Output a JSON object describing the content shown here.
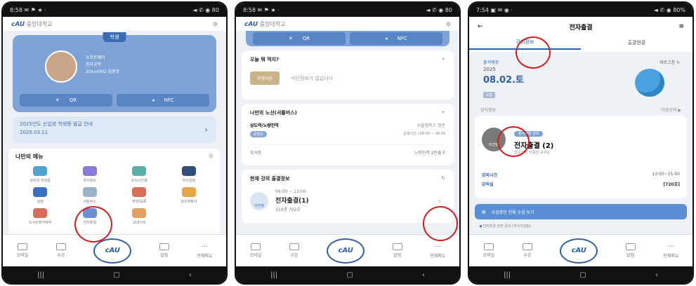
{
  "common": {
    "logo": "cAU",
    "logo_sub": "중앙대학교",
    "bottom_nav": [
      "모바일",
      "수강",
      "cAU",
      "알림",
      "전체메뉴"
    ]
  },
  "phone1": {
    "status_left": "8:58 ✉ ⚑ ★ ·",
    "status_right": "◄ ✆ ◉ 80",
    "id_tag": "학생",
    "id_lines": [
      "소프트웨어",
      "전자공학",
      "20xxx002 김중앙"
    ],
    "qr_label": "QR",
    "nfc_label": "NFC",
    "banner_title": "2025년도 신입생 학생증 발급 안내",
    "banner_date": "2025.03.11",
    "menu_title": "나만의 메뉴",
    "menu_items": [
      "모바일 학생증",
      "학사정보",
      "강의시간표",
      "학사일정",
      "설정",
      "셔틀버스",
      "장학/등록",
      "강의계획서",
      "도서관좌석예약",
      "전자출결",
      "교내식당"
    ]
  },
  "phone2": {
    "status_left": "8:58 ✉ ⚑ ★ ·",
    "status_right": "◄ ✆ ◉ 80",
    "qr_label": "QR",
    "nfc_label": "NFC",
    "lunch_title": "오늘 뭐 먹지?",
    "lunch_tag": "학생식당",
    "lunch_empty": "식단정보가 없습니다",
    "bus_title": "나만의 노선(셔틀버스)",
    "bus_route": "상도역/노량진역",
    "bus_tag": "운행중",
    "bus_dest": "서울캠퍼스 정문",
    "bus_time": "운행시간 | 08:00 ~ 18:00",
    "bus_from": "흑석동",
    "bus_to": "노량진역 2번출구",
    "attend_title": "현재 강의 출결정보",
    "attend_time": "09:00 ~ 13:00",
    "attend_course": "전자출결(1)",
    "attend_room": "310관 702호",
    "attend_badge": "미진행"
  },
  "phone3": {
    "status_left": "7:54 ▣ ✉ ◉ ·",
    "status_right": "◄ ✆ ◉ 80%",
    "title": "전자출결",
    "tab_active": "강의정보",
    "tab_other": "출결현황",
    "date_label": "출석예정",
    "year": "2025",
    "date": "08.02.토",
    "date_tag": "오늘",
    "mascot_label": "새로고침 ↻",
    "section_label": "강의정보",
    "refresh_label": "다음강의 ▶",
    "status_circle": "미진행",
    "course_tag": "출석예정 강의",
    "course_name": "전자출결 (2)",
    "course_prof": "전공선택, 이중앙 교수님",
    "time_label": "강의시간",
    "time_value": "13:00~15:50",
    "room_label": "강의실",
    "room_value": "[720호]",
    "action": "수업중인 전체 수업 보기",
    "note": "전자출결 관련 문의 (학사지원팀)"
  }
}
